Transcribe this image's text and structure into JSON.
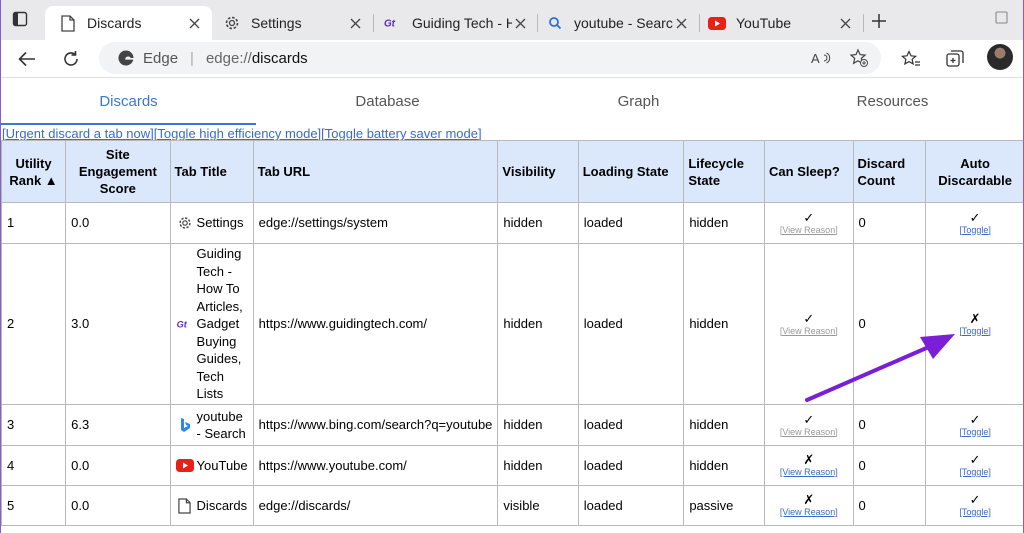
{
  "browser": {
    "tabs": [
      {
        "label": "Discards",
        "icon": "document-icon",
        "active": true
      },
      {
        "label": "Settings",
        "icon": "gear-icon",
        "active": false
      },
      {
        "label": "Guiding Tech - Hov",
        "icon": "guidingtech-logo-icon",
        "active": false
      },
      {
        "label": "youtube - Search",
        "icon": "search-icon",
        "active": false
      },
      {
        "label": "YouTube",
        "icon": "youtube-icon",
        "active": false
      }
    ],
    "address": {
      "site_label": "Edge",
      "url_scheme": "edge://",
      "url_host": "discards"
    },
    "avatar_color": "#2a2a2a"
  },
  "page": {
    "tabs": [
      "Discards",
      "Database",
      "Graph",
      "Resources"
    ],
    "active_tab": "Discards",
    "accent_color": "#3a78d6",
    "links": [
      "[Urgent discard a tab now]",
      "[Toggle high efficiency mode]",
      "[Toggle battery saver mode]"
    ],
    "table": {
      "header_bg": "#dbe8fb",
      "columns": [
        "Utility Rank ▲",
        "Site Engagement Score",
        "Tab Title",
        "Tab URL",
        "Visibility",
        "Loading State",
        "Lifecycle State",
        "Can Sleep?",
        "Discard Count",
        "Auto Discardable"
      ],
      "rows": [
        {
          "rank": "1",
          "score": "0.0",
          "icon": "gear-icon",
          "title": "Settings",
          "url": "edge://settings/system",
          "visibility": "hidden",
          "loading": "loaded",
          "lifecycle": "hidden",
          "can_sleep": "✓",
          "reason": "[View Reason]",
          "reason_enabled": false,
          "discards": "0",
          "auto": "✓",
          "toggle": "[Toggle]"
        },
        {
          "rank": "2",
          "score": "3.0",
          "icon": "guidingtech-logo-icon",
          "title": "Guiding Tech - How To Articles, Gadget Buying Guides, Tech Lists",
          "url": "https://www.guidingtech.com/",
          "visibility": "hidden",
          "loading": "loaded",
          "lifecycle": "hidden",
          "can_sleep": "✓",
          "reason": "[View Reason]",
          "reason_enabled": false,
          "discards": "0",
          "auto": "✗",
          "toggle": "[Toggle]"
        },
        {
          "rank": "3",
          "score": "6.3",
          "icon": "bing-icon",
          "title": "youtube - Search",
          "url": "https://www.bing.com/search?q=youtube",
          "visibility": "hidden",
          "loading": "loaded",
          "lifecycle": "hidden",
          "can_sleep": "✓",
          "reason": "[View Reason]",
          "reason_enabled": false,
          "discards": "0",
          "auto": "✓",
          "toggle": "[Toggle]"
        },
        {
          "rank": "4",
          "score": "0.0",
          "icon": "youtube-icon",
          "title": "YouTube",
          "url": "https://www.youtube.com/",
          "visibility": "hidden",
          "loading": "loaded",
          "lifecycle": "hidden",
          "can_sleep": "✗",
          "reason": "[View Reason]",
          "reason_enabled": true,
          "discards": "0",
          "auto": "✓",
          "toggle": "[Toggle]"
        },
        {
          "rank": "5",
          "score": "0.0",
          "icon": "document-icon",
          "title": "Discards",
          "url": "edge://discards/",
          "visibility": "visible",
          "loading": "loaded",
          "lifecycle": "passive",
          "can_sleep": "✗",
          "reason": "[View Reason]",
          "reason_enabled": true,
          "discards": "0",
          "auto": "✓",
          "toggle": "[Toggle]"
        }
      ]
    }
  },
  "annotation": {
    "color": "#7a1fd6",
    "type": "arrow",
    "points_to": "[Toggle] link in row 2"
  }
}
